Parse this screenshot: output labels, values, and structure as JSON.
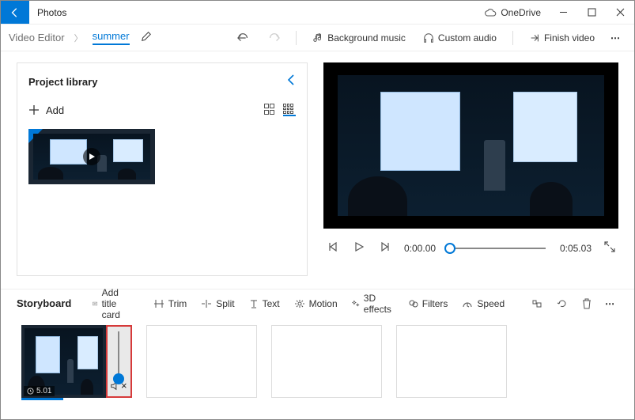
{
  "app": {
    "title": "Photos",
    "onedrive_label": "OneDrive"
  },
  "breadcrumb": {
    "root": "Video Editor",
    "project": "summer"
  },
  "toolbar": {
    "bg_music": "Background music",
    "custom_audio": "Custom audio",
    "finish": "Finish video"
  },
  "library": {
    "title": "Project library",
    "add_label": "Add"
  },
  "preview": {
    "current_time": "0:00.00",
    "duration": "0:05.03"
  },
  "storybar": {
    "title": "Storyboard",
    "title_card": "Add title card",
    "trim": "Trim",
    "split": "Split",
    "text": "Text",
    "motion": "Motion",
    "effects": "3D effects",
    "filters": "Filters",
    "speed": "Speed"
  },
  "clip": {
    "duration": "5.01"
  }
}
